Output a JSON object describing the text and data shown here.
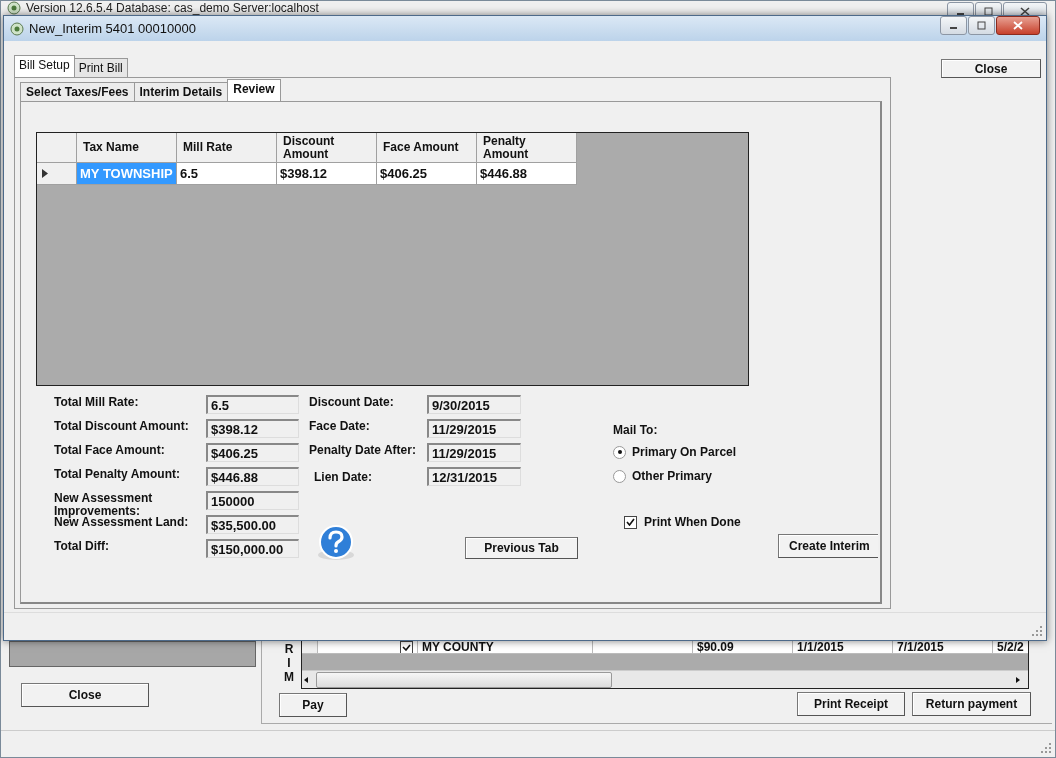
{
  "background_window": {
    "title": "Version 12.6.5.4 Database: cas_demo Server:localhost",
    "grid_side_letters": [
      "R",
      "I",
      "M"
    ],
    "grid_row": {
      "checked": true,
      "cells": [
        "MY COUNTY",
        "",
        "$90.09",
        "1/1/2015",
        "7/1/2015",
        "5/2/2"
      ]
    },
    "buttons": {
      "close": "Close",
      "pay": "Pay",
      "print_receipt": "Print Receipt",
      "return_payment": "Return payment"
    }
  },
  "dialog": {
    "title": "New_Interim 5401 00010000",
    "outer_tabs": [
      {
        "label": "Bill Setup",
        "selected": true
      },
      {
        "label": "Print Bill",
        "selected": false
      }
    ],
    "inner_tabs": [
      {
        "label": "Select Taxes/Fees",
        "selected": false
      },
      {
        "label": "Interim Details",
        "selected": false
      },
      {
        "label": "Review",
        "selected": true
      }
    ],
    "close_button": "Close",
    "table": {
      "columns": [
        "Tax Name",
        "Mill Rate",
        "Discount Amount",
        "Face Amount",
        "Penalty Amount"
      ],
      "rows": [
        {
          "current": true,
          "cells": [
            {
              "text": "MY TOWNSHIP",
              "selected": true
            },
            {
              "text": "6.5",
              "selected": false
            },
            {
              "text": "$398.12",
              "selected": false
            },
            {
              "text": "$406.25",
              "selected": false
            },
            {
              "text": "$446.88",
              "selected": false
            }
          ]
        }
      ]
    },
    "totals": [
      {
        "label": "Total Mill Rate:",
        "value": "6.5"
      },
      {
        "label": "Total Discount Amount:",
        "value": "$398.12"
      },
      {
        "label": "Total Face Amount:",
        "value": "$406.25"
      },
      {
        "label": "Total Penalty Amount:",
        "value": "$446.88"
      },
      {
        "label": "New Assessment Improvements:",
        "value": "150000"
      },
      {
        "label": "New Assessment Land:",
        "value": "$35,500.00"
      },
      {
        "label": "Total Diff:",
        "value": "$150,000.00"
      }
    ],
    "dates": [
      {
        "label": "Discount Date:",
        "value": "9/30/2015"
      },
      {
        "label": "Face Date:",
        "value": "11/29/2015"
      },
      {
        "label": "Penalty Date After:",
        "value": "11/29/2015"
      },
      {
        "label": "Lien Date:",
        "value": "12/31/2015"
      }
    ],
    "mail_to": {
      "label": "Mail To:",
      "options": [
        {
          "label": "Primary On Parcel",
          "selected": true
        },
        {
          "label": "Other Primary",
          "selected": false
        }
      ]
    },
    "print_when_done": {
      "label": "Print When Done",
      "checked": true
    },
    "previous_tab_button": "Previous Tab",
    "create_button": "Create Interim"
  }
}
